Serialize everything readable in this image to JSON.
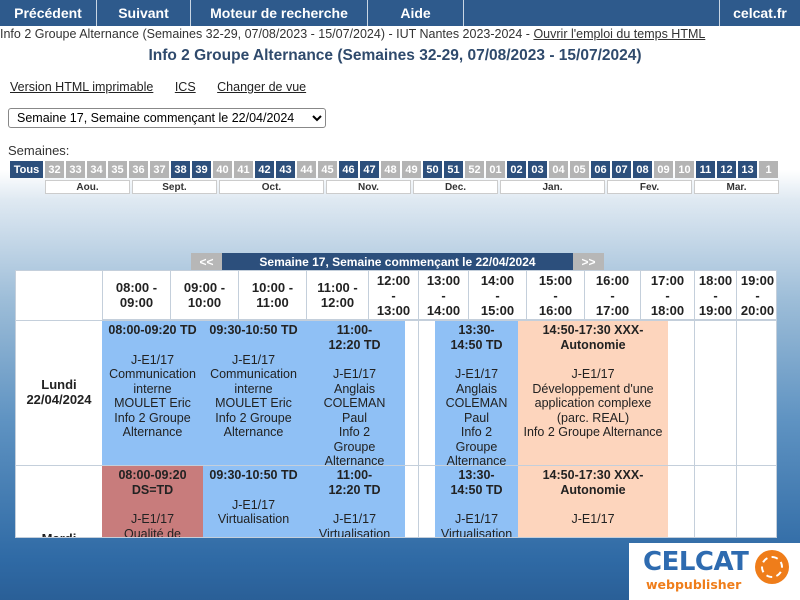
{
  "nav": {
    "prev": "Précédent",
    "next": "Suivant",
    "search": "Moteur de recherche",
    "help": "Aide",
    "site": "celcat.fr"
  },
  "info_line": {
    "text": "Info 2 Groupe Alternance (Semaines 32-29, 07/08/2023 - 15/07/2024) - IUT Nantes 2023-2024 - ",
    "link": "Ouvrir l'emploi du temps HTML"
  },
  "page_title": "Info 2 Groupe Alternance (Semaines 32-29, 07/08/2023 - 15/07/2024)",
  "links": {
    "printable": "Version HTML imprimable",
    "ics": "ICS",
    "change_view": "Changer de vue"
  },
  "week_select": "Semaine 17, Semaine commençant le 22/04/2024",
  "weeks_label": "Semaines:",
  "weeks": [
    {
      "l": "Tous",
      "on": true
    },
    {
      "l": "32",
      "on": false
    },
    {
      "l": "33",
      "on": false
    },
    {
      "l": "34",
      "on": false
    },
    {
      "l": "35",
      "on": false
    },
    {
      "l": "36",
      "on": false
    },
    {
      "l": "37",
      "on": false
    },
    {
      "l": "38",
      "on": true
    },
    {
      "l": "39",
      "on": true
    },
    {
      "l": "40",
      "on": false
    },
    {
      "l": "41",
      "on": false
    },
    {
      "l": "42",
      "on": true
    },
    {
      "l": "43",
      "on": true
    },
    {
      "l": "44",
      "on": false
    },
    {
      "l": "45",
      "on": false
    },
    {
      "l": "46",
      "on": true
    },
    {
      "l": "47",
      "on": true
    },
    {
      "l": "48",
      "on": false
    },
    {
      "l": "49",
      "on": false
    },
    {
      "l": "50",
      "on": true
    },
    {
      "l": "51",
      "on": true
    },
    {
      "l": "52",
      "on": false
    },
    {
      "l": "01",
      "on": false
    },
    {
      "l": "02",
      "on": true
    },
    {
      "l": "03",
      "on": true
    },
    {
      "l": "04",
      "on": false
    },
    {
      "l": "05",
      "on": false
    },
    {
      "l": "06",
      "on": true
    },
    {
      "l": "07",
      "on": true
    },
    {
      "l": "08",
      "on": true
    },
    {
      "l": "09",
      "on": false
    },
    {
      "l": "10",
      "on": false
    },
    {
      "l": "11",
      "on": true
    },
    {
      "l": "12",
      "on": true
    },
    {
      "l": "13",
      "on": true
    },
    {
      "l": "1",
      "on": false
    }
  ],
  "months": [
    "Aou.",
    "Sept.",
    "Oct.",
    "Nov.",
    "Dec.",
    "Jan.",
    "Fev.",
    "Mar."
  ],
  "week_bar": {
    "prev": "<<",
    "title": "Semaine 17, Semaine commençant le 22/04/2024",
    "next": ">>"
  },
  "time_headers": [
    "08:00 - 09:00",
    "09:00 - 10:00",
    "10:00 - 11:00",
    "11:00 - 12:00",
    "12:00 - 13:00",
    "13:00 - 14:00",
    "14:00 - 15:00",
    "15:00 - 16:00",
    "16:00 - 17:00",
    "17:00 - 18:00",
    "18:00 - 19:00",
    "19:00 - 20:00"
  ],
  "days": [
    {
      "label": "Lundi\n22/04/2024",
      "events": [
        {
          "color": "blue",
          "title": "08:00-09:20 TD",
          "body": "J-E1/17\nCommunication interne\nMOULET Eric\nInfo 2 Groupe Alternance"
        },
        {
          "color": "blue",
          "title": "09:30-10:50 TD",
          "body": "J-E1/17\nCommunication interne\nMOULET Eric\nInfo 2 Groupe Alternance"
        },
        {
          "color": "blue",
          "title": "11:00-\n12:20 TD",
          "body": "J-E1/17\nAnglais\nCOLEMAN\nPaul\nInfo 2\nGroupe\nAlternance"
        },
        {
          "color": "blue",
          "title": "13:30-\n14:50 TD",
          "body": "J-E1/17\nAnglais\nCOLEMAN\nPaul\nInfo 2\nGroupe\nAlternance"
        },
        {
          "color": "peach",
          "title": "14:50-17:30 XXX-Autonomie",
          "body": "J-E1/17\nDéveloppement d'une application complexe (parc. REAL)\nInfo 2 Groupe Alternance"
        }
      ]
    },
    {
      "label": "Mardi",
      "events": [
        {
          "color": "red",
          "title": "08:00-09:20 DS=TD",
          "body": "J-E1/17\nQualité de"
        },
        {
          "color": "blue",
          "title": "09:30-10:50 TD",
          "body": "J-E1/17\nVirtualisation"
        },
        {
          "color": "blue",
          "title": "11:00-\n12:20 TD",
          "body": "J-E1/17\nVirtualisation"
        },
        {
          "color": "blue",
          "title": "13:30-\n14:50 TD",
          "body": "J-E1/17\nVirtualisation"
        },
        {
          "color": "peach",
          "title": "14:50-17:30 XXX-Autonomie",
          "body": "J-E1/17"
        }
      ]
    }
  ],
  "logo": {
    "brand": "CELCAT",
    "sub": "webpublisher"
  }
}
